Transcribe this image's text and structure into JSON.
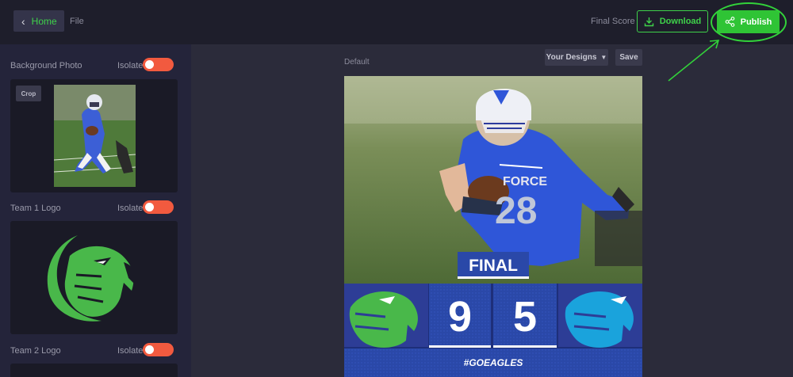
{
  "topbar": {
    "home_label": "Home",
    "file_label": "File",
    "template_name": "Final Score",
    "download_label": "Download",
    "publish_label": "Publish"
  },
  "sidebar": {
    "background_photo_label": "Background Photo",
    "team1_logo_label": "Team 1 Logo",
    "team2_logo_label": "Team 2 Logo",
    "isolate_label": "Isolate",
    "crop_label": "Crop"
  },
  "canvas": {
    "default_label": "Default",
    "your_designs_label": "Your Designs",
    "save_label": "Save"
  },
  "design": {
    "status_text": "FINAL",
    "team1_score": "9",
    "team2_score": "5",
    "hashtag": "#GOEAGLES",
    "jersey_text": "FORCE",
    "jersey_number": "28"
  },
  "colors": {
    "accent_green": "#2fc435",
    "toggle_orange": "#f25a3f",
    "score_blue": "#2a48a8",
    "team2_cyan": "#1aa3dc",
    "team1_green": "#49b84a"
  }
}
